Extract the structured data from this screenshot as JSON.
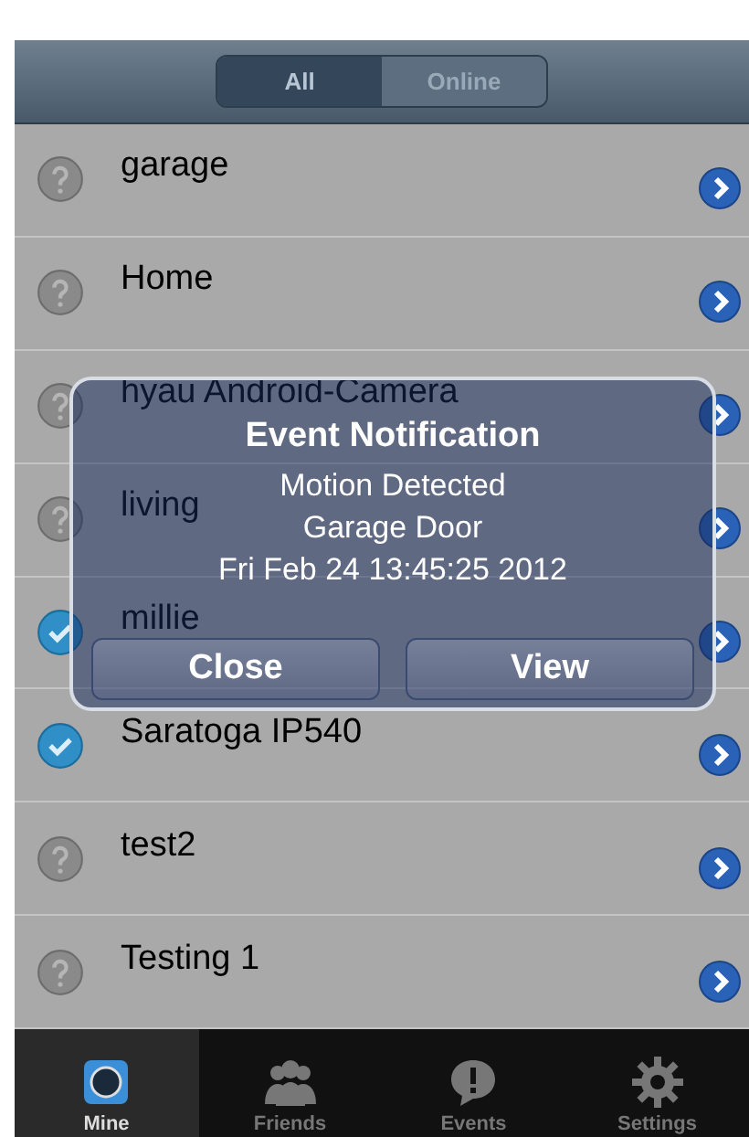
{
  "segments": [
    {
      "label": "All",
      "selected": true
    },
    {
      "label": "Online",
      "selected": false
    }
  ],
  "devices": [
    {
      "name": "garage",
      "online": false
    },
    {
      "name": "Home",
      "online": false
    },
    {
      "name": "hyau Android-Camera",
      "online": false
    },
    {
      "name": "living",
      "online": false
    },
    {
      "name": "millie",
      "online": true
    },
    {
      "name": "Saratoga IP540",
      "online": true
    },
    {
      "name": "test2",
      "online": false
    },
    {
      "name": "Testing 1",
      "online": false
    }
  ],
  "alert": {
    "title": "Event Notification",
    "lines": [
      "Motion Detected",
      "Garage Door",
      "Fri Feb 24 13:45:25 2012"
    ],
    "buttons": [
      "Close",
      "View"
    ]
  },
  "tabbar": [
    {
      "label": "Mine",
      "kind": "camera",
      "selected": true
    },
    {
      "label": "Friends",
      "kind": "people",
      "selected": false
    },
    {
      "label": "Events",
      "kind": "alert",
      "selected": false
    },
    {
      "label": "Settings",
      "kind": "gear",
      "selected": false
    }
  ]
}
